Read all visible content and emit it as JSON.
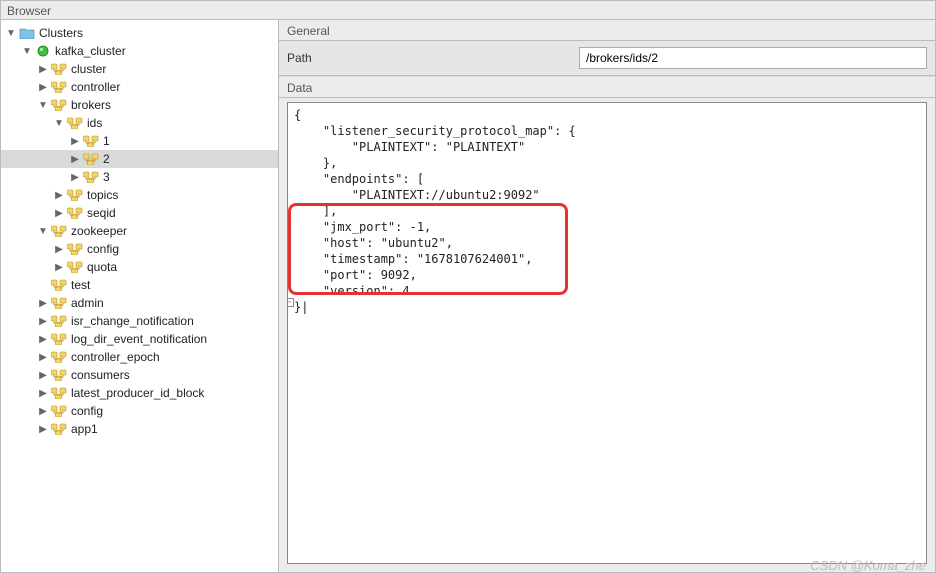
{
  "window_title": "Browser",
  "right_panel": {
    "general_label": "General",
    "path_label": "Path",
    "path_value": "/brokers/ids/2",
    "data_label": "Data",
    "data_text": "{\n    \"listener_security_protocol_map\": {\n        \"PLAINTEXT\": \"PLAINTEXT\"\n    },\n    \"endpoints\": [\n        \"PLAINTEXT://ubuntu2:9092\"\n    ],\n    \"jmx_port\": -1,\n    \"host\": \"ubuntu2\",\n    \"timestamp\": \"1678107624001\",\n    \"port\": 9092,\n    \"version\": 4\n}|"
  },
  "tree": [
    {
      "indent": 1,
      "twisty": "open",
      "icon": "folder",
      "label": "Clusters",
      "sel": false
    },
    {
      "indent": 2,
      "twisty": "open",
      "icon": "green-dot",
      "label": "kafka_cluster",
      "sel": false
    },
    {
      "indent": 3,
      "twisty": "closed",
      "icon": "znode",
      "label": "cluster",
      "sel": false
    },
    {
      "indent": 3,
      "twisty": "closed",
      "icon": "znode",
      "label": "controller",
      "sel": false
    },
    {
      "indent": 3,
      "twisty": "open",
      "icon": "znode",
      "label": "brokers",
      "sel": false
    },
    {
      "indent": 4,
      "twisty": "open",
      "icon": "znode",
      "label": "ids",
      "sel": false
    },
    {
      "indent": 5,
      "twisty": "closed",
      "icon": "znode",
      "label": "1",
      "sel": false
    },
    {
      "indent": 5,
      "twisty": "closed",
      "icon": "znode",
      "label": "2",
      "sel": true
    },
    {
      "indent": 5,
      "twisty": "closed",
      "icon": "znode",
      "label": "3",
      "sel": false
    },
    {
      "indent": 4,
      "twisty": "closed",
      "icon": "znode",
      "label": "topics",
      "sel": false
    },
    {
      "indent": 4,
      "twisty": "closed",
      "icon": "znode",
      "label": "seqid",
      "sel": false
    },
    {
      "indent": 3,
      "twisty": "open",
      "icon": "znode",
      "label": "zookeeper",
      "sel": false
    },
    {
      "indent": 4,
      "twisty": "closed",
      "icon": "znode",
      "label": "config",
      "sel": false
    },
    {
      "indent": 4,
      "twisty": "closed",
      "icon": "znode",
      "label": "quota",
      "sel": false
    },
    {
      "indent": 3,
      "twisty": "none",
      "icon": "znode",
      "label": "test",
      "sel": false
    },
    {
      "indent": 3,
      "twisty": "closed",
      "icon": "znode",
      "label": "admin",
      "sel": false
    },
    {
      "indent": 3,
      "twisty": "closed",
      "icon": "znode",
      "label": "isr_change_notification",
      "sel": false
    },
    {
      "indent": 3,
      "twisty": "closed",
      "icon": "znode",
      "label": "log_dir_event_notification",
      "sel": false
    },
    {
      "indent": 3,
      "twisty": "closed",
      "icon": "znode",
      "label": "controller_epoch",
      "sel": false
    },
    {
      "indent": 3,
      "twisty": "closed",
      "icon": "znode",
      "label": "consumers",
      "sel": false
    },
    {
      "indent": 3,
      "twisty": "closed",
      "icon": "znode",
      "label": "latest_producer_id_block",
      "sel": false
    },
    {
      "indent": 3,
      "twisty": "closed",
      "icon": "znode",
      "label": "config",
      "sel": false
    },
    {
      "indent": 3,
      "twisty": "closed",
      "icon": "znode",
      "label": "app1",
      "sel": false
    }
  ],
  "watermark": "CSDN @Koma_zhe"
}
